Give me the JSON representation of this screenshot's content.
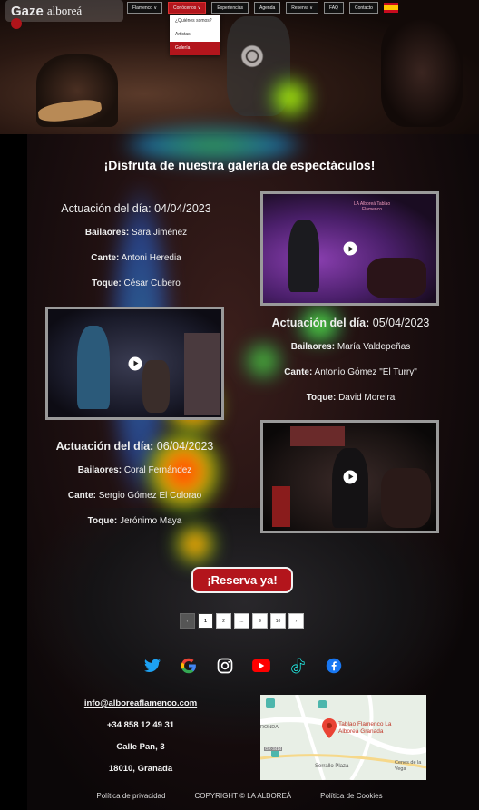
{
  "brand": {
    "overlay_label": "Gaze",
    "logo_text": "alboreá"
  },
  "nav": {
    "items": [
      {
        "label": "Flamenco ∨"
      },
      {
        "label": "Conócenos ∨",
        "active": true
      },
      {
        "label": "Experiencias"
      },
      {
        "label": "Agenda"
      },
      {
        "label": "Reserva ∨"
      },
      {
        "label": "FAQ"
      },
      {
        "label": "Contacto"
      }
    ],
    "dropdown": [
      {
        "label": "¿Quiénes somos?"
      },
      {
        "label": "Artistas"
      },
      {
        "label": "Galería",
        "selected": true
      }
    ]
  },
  "gallery": {
    "title": "¡Disfruta de nuestra galería de espectáculos!",
    "performances": [
      {
        "date_label": "Actuación del día:",
        "date": "04/04/2023",
        "dancers_label": "Bailaores:",
        "dancers": "Sara Jiménez",
        "singer_label": "Cante:",
        "singer": "Antoni Heredia",
        "guitar_label": "Toque:",
        "guitar": "César Cubero"
      },
      {
        "date_label": "Actuación del día:",
        "date": "05/04/2023",
        "dancers_label": "Bailaores:",
        "dancers": "María Valdepeñas",
        "singer_label": "Cante:",
        "singer": "Antonio Gómez \"El Turry\"",
        "guitar_label": "Toque:",
        "guitar": "David Moreira"
      },
      {
        "date_label": "Actuación del día:",
        "date": "06/04/2023",
        "dancers_label": "Bailaores:",
        "dancers": "Coral Fernández",
        "singer_label": "Cante:",
        "singer": "Sergio Gómez El Colorao",
        "guitar_label": "Toque:",
        "guitar": "Jerónimo Maya"
      }
    ],
    "video_caption": "LA Alboreá Tablao Flamenco"
  },
  "cta": {
    "label": "¡Reserva ya!"
  },
  "pagination": {
    "pages": [
      "‹",
      "1",
      "2",
      "...",
      "9",
      "10",
      "›"
    ],
    "current": "1"
  },
  "social": [
    "twitter-icon",
    "google-icon",
    "instagram-icon",
    "youtube-icon",
    "tiktok-icon",
    "facebook-icon"
  ],
  "contact": {
    "email": "info@alboreaflamenco.com",
    "phone": "+34 858 12 49 31",
    "street": "Calle Pan, 3",
    "city": "18010, Granada"
  },
  "map": {
    "place": "Tablao Flamenco La Alboreá Granada",
    "area1": "RONDA",
    "area2": "Serrallo Plaza",
    "area3": "Cenes de la Vega",
    "road": "GR-3414"
  },
  "footer": {
    "privacy": "Política de privacidad",
    "copyright": "COPYRIGHT © LA ALBOREÁ",
    "cookies": "Política de Cookies"
  },
  "colors": {
    "accent": "#b3151c",
    "background": "#0b0709",
    "text": "#ffffff"
  }
}
